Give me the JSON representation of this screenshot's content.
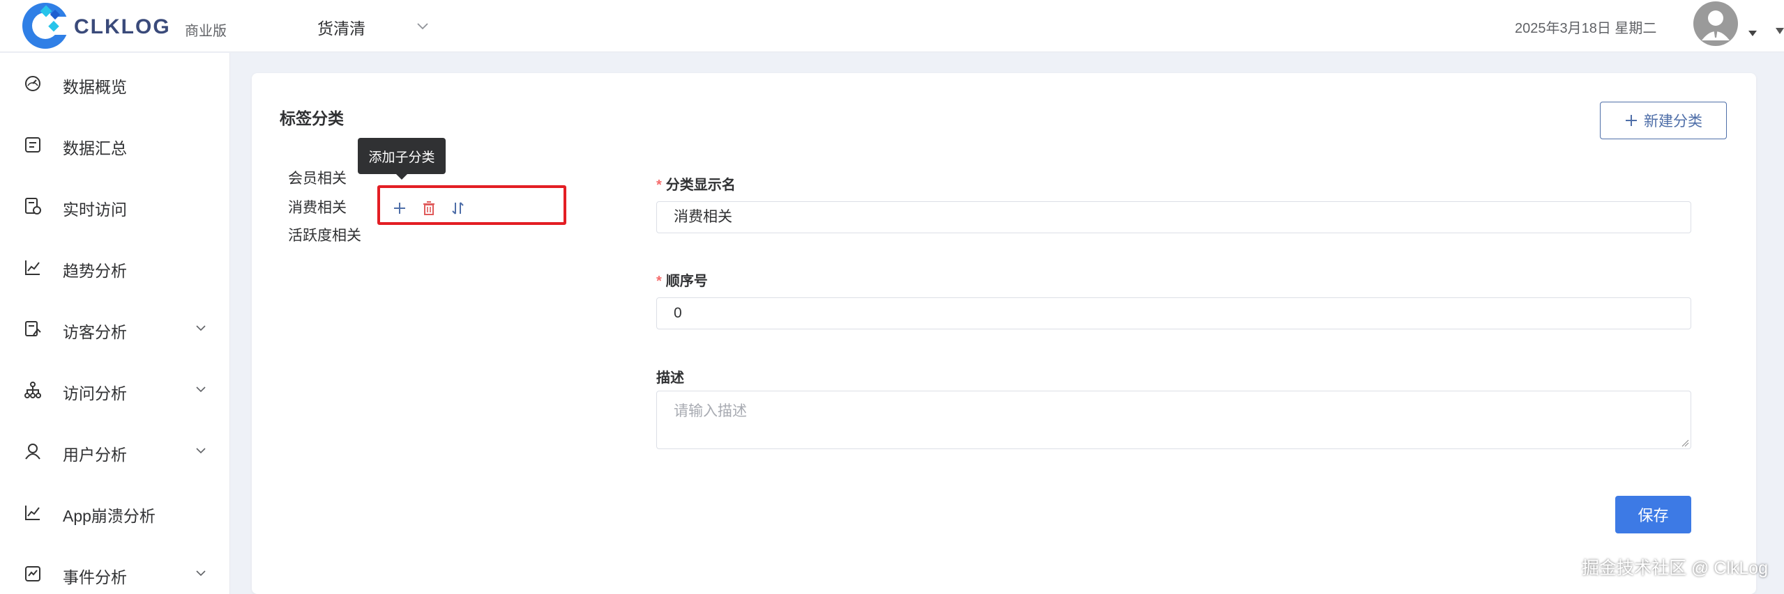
{
  "header": {
    "brand": "CLKLOG",
    "edition": "商业版",
    "project": "货清清",
    "date": "2025年3月18日 星期二"
  },
  "sidebar": {
    "items": [
      {
        "label": "数据概览",
        "icon": "dashboard-icon",
        "expandable": false
      },
      {
        "label": "数据汇总",
        "icon": "report-icon",
        "expandable": false
      },
      {
        "label": "实时访问",
        "icon": "realtime-icon",
        "expandable": false
      },
      {
        "label": "趋势分析",
        "icon": "trend-icon",
        "expandable": false
      },
      {
        "label": "访客分析",
        "icon": "visitor-icon",
        "expandable": true
      },
      {
        "label": "访问分析",
        "icon": "access-icon",
        "expandable": true
      },
      {
        "label": "用户分析",
        "icon": "user-icon",
        "expandable": true
      },
      {
        "label": "App崩溃分析",
        "icon": "crash-chart-icon",
        "expandable": false
      },
      {
        "label": "事件分析",
        "icon": "event-icon",
        "expandable": true
      }
    ]
  },
  "main": {
    "title": "标签分类",
    "new_button": "新建分类",
    "tree": [
      {
        "label": "会员相关"
      },
      {
        "label": "消费相关",
        "selected": true
      },
      {
        "label": "活跃度相关"
      }
    ],
    "tooltip": "添加子分类",
    "form": {
      "name_label": "分类显示名",
      "name_value": "消费相关",
      "order_label": "顺序号",
      "order_value": "0",
      "desc_label": "描述",
      "desc_placeholder": "请输入描述",
      "save": "保存"
    }
  },
  "watermark": "掘金技术社区 @ ClkLog",
  "colors": {
    "accent": "#3d7ae5",
    "outline_button": "#4e6ea8",
    "required": "#f56c6c",
    "delete": "#e05a5a",
    "highlight": "#e31e24"
  }
}
